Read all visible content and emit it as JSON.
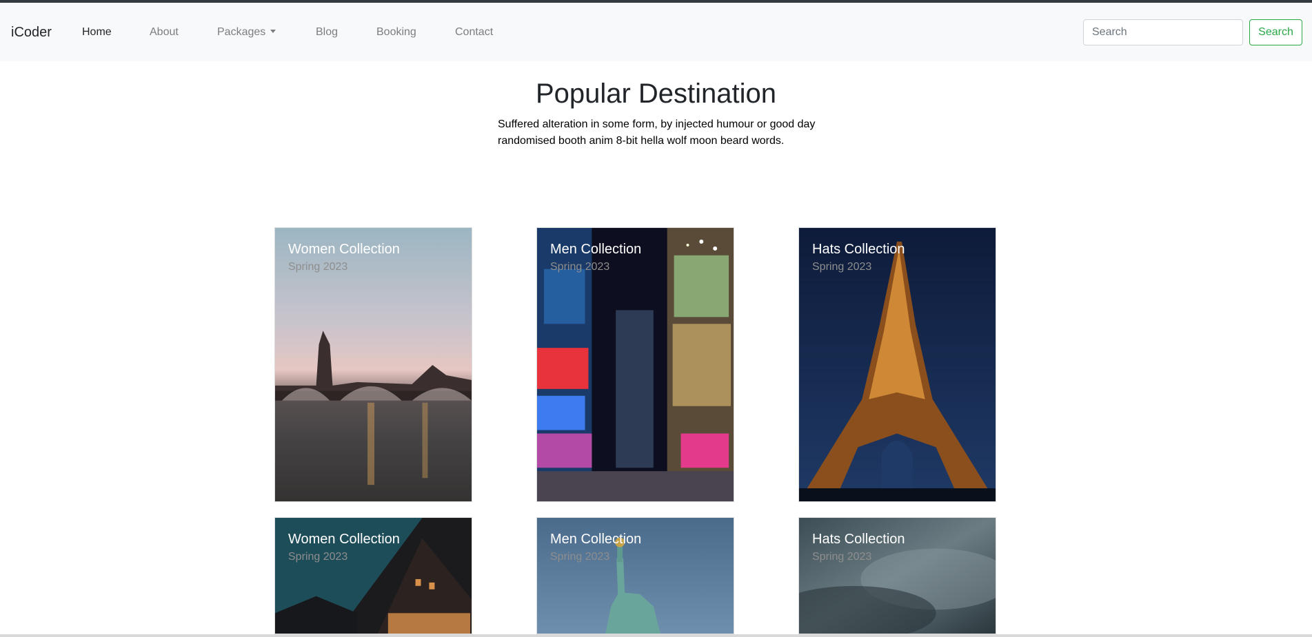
{
  "navbar": {
    "brand": "iCoder",
    "items": [
      {
        "label": "Home",
        "active": true
      },
      {
        "label": "About",
        "active": false
      },
      {
        "label": "Packages",
        "active": false,
        "dropdown": true
      },
      {
        "label": "Blog",
        "active": false
      },
      {
        "label": "Booking",
        "active": false
      },
      {
        "label": "Contact",
        "active": false
      }
    ],
    "search_placeholder": "Search",
    "search_button": "Search"
  },
  "hero": {
    "title": "Popular Destination",
    "subtitle_line1": "Suffered alteration in some form, by injected humour or good day",
    "subtitle_line2": "randomised booth anim 8-bit hella wolf moon beard words."
  },
  "cards": [
    {
      "title": "Women Collection",
      "subtitle": "Spring 2023",
      "image": "london-bridge-dusk"
    },
    {
      "title": "Men Collection",
      "subtitle": "Spring 2023",
      "image": "times-square-night"
    },
    {
      "title": "Hats Collection",
      "subtitle": "Spring 2023",
      "image": "eiffel-tower-night"
    },
    {
      "title": "Women Collection",
      "subtitle": "Spring 2023",
      "image": "gabled-house-night"
    },
    {
      "title": "Men Collection",
      "subtitle": "Spring 2023",
      "image": "statue-of-liberty"
    },
    {
      "title": "Hats Collection",
      "subtitle": "Spring 2023",
      "image": "stormy-sky"
    }
  ],
  "colors": {
    "navbar_bg": "#f8f9fa",
    "search_accent": "#28a745"
  }
}
